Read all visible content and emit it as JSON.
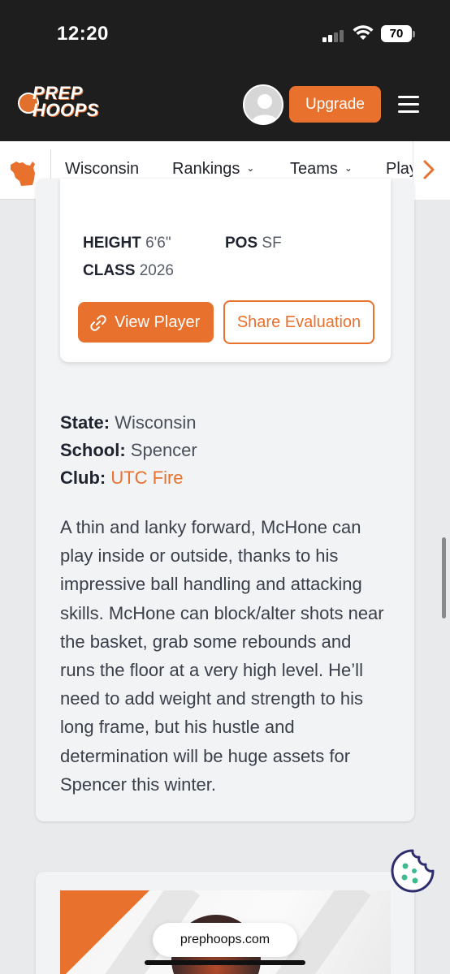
{
  "status_bar": {
    "time": "12:20",
    "battery": "70"
  },
  "header": {
    "logo_line1": "PREP",
    "logo_line2": "HOOPS",
    "upgrade_label": "Upgrade"
  },
  "nav": {
    "items": [
      {
        "label": "Wisconsin"
      },
      {
        "label": "Rankings",
        "chevron": "⌄"
      },
      {
        "label": "Teams",
        "chevron": "⌄"
      },
      {
        "label": "Play"
      }
    ]
  },
  "player_card": {
    "height_label": "HEIGHT",
    "height_value": "6'6\"",
    "pos_label": "POS",
    "pos_value": "SF",
    "class_label": "CLASS",
    "class_value": "2026",
    "view_player_label": "View Player",
    "share_evaluation_label": "Share Evaluation"
  },
  "info": {
    "state_label": "State:",
    "state_value": "Wisconsin",
    "school_label": "School:",
    "school_value": "Spencer",
    "club_label": "Club:",
    "club_value": "UTC Fire"
  },
  "description": "A thin and lanky forward, McHone can play inside or outside, thanks to his impressive ball handling and attacking skills. McHone can block/alter shots near the basket, grab some rebounds and runs the floor at a very high level. He’ll need to add weight and strength to his long frame, but his hustle and determination will be huge assets for Spencer this winter.",
  "browser": {
    "url": "prephoops.com"
  },
  "colors": {
    "accent": "#e8712e",
    "header_bg": "#1e1e1e"
  }
}
